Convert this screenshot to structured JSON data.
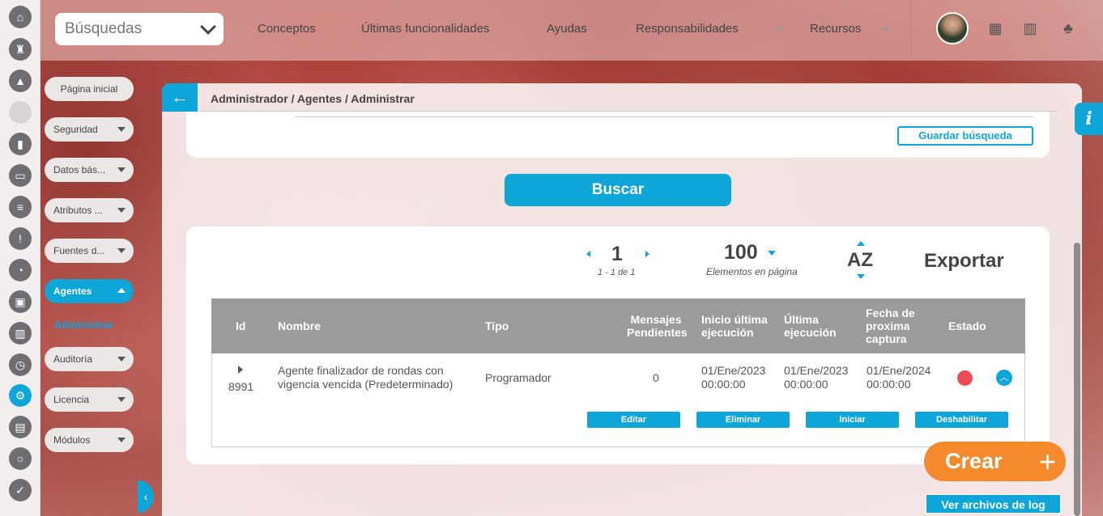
{
  "search": {
    "label": "Búsquedas"
  },
  "nav": {
    "items": [
      "Conceptos",
      "Últimas funcionalidades",
      "Ayudas",
      "Responsabilidades",
      "Recursos"
    ]
  },
  "sidebar": {
    "items": [
      {
        "label": "Página inicial"
      },
      {
        "label": "Seguridad"
      },
      {
        "label": "Datos bás..."
      },
      {
        "label": "Atributos ..."
      },
      {
        "label": "Fuentes d..."
      },
      {
        "label": "Agentes"
      },
      {
        "label": "Auditoría"
      },
      {
        "label": "Licencia"
      },
      {
        "label": "Módulos"
      }
    ],
    "active_sub": "Administrar"
  },
  "breadcrumb": "Administrador / Agentes / Administrar",
  "buttons": {
    "save_search": "Guardar búsqueda",
    "search": "Buscar",
    "export": "Exportar",
    "create": "Crear",
    "log": "Ver archivos de log"
  },
  "pager": {
    "page": "1",
    "range": "1 - 1 de 1",
    "per_page": "100",
    "per_page_label": "Elementos en página",
    "sort": "AZ"
  },
  "table": {
    "headers": {
      "id": "Id",
      "name": "Nombre",
      "type": "Tipo",
      "pending": [
        "Mensajes",
        "Pendientes"
      ],
      "start": [
        "Inicio última",
        "ejecución"
      ],
      "last": [
        "Última",
        "ejecución"
      ],
      "next": [
        "Fecha de",
        "proxima",
        "captura"
      ],
      "status": "Estado"
    },
    "rows": [
      {
        "id": "8991",
        "name": [
          "Agente finalizador de rondas con",
          "vigencia vencida (Predeterminado)"
        ],
        "type": "Programador",
        "pending": "0",
        "start": [
          "01/Ene/2023",
          "00:00:00"
        ],
        "last": [
          "01/Ene/2023",
          "00:00:00"
        ],
        "next": [
          "01/Ene/2024",
          "00:00:00"
        ],
        "status_color": "#f04b54"
      }
    ],
    "actions": [
      "Editar",
      "Eliminar",
      "Iniciar",
      "Deshabilitar"
    ]
  },
  "colors": {
    "accent": "#0ea5d8",
    "create": "#f48a2c",
    "status_off": "#f04b54"
  }
}
